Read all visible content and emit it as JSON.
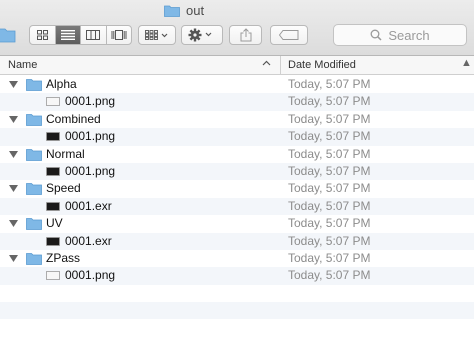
{
  "window": {
    "title": "out"
  },
  "toolbar": {
    "view_modes": [
      "icon-view",
      "list-view",
      "column-view",
      "coverflow-view"
    ],
    "active_view": "list-view",
    "arrange": "grid-icon",
    "action": "gear-icon",
    "share": "share-icon",
    "tags": "tag-icon",
    "search_placeholder": "Search"
  },
  "columns": {
    "name": "Name",
    "date": "Date Modified"
  },
  "rows": [
    {
      "type": "folder",
      "name": "Alpha",
      "date": "Today, 5:07 PM"
    },
    {
      "type": "file",
      "thumb": "light",
      "name": "0001.png",
      "date": "Today, 5:07 PM"
    },
    {
      "type": "folder",
      "name": "Combined",
      "date": "Today, 5:07 PM"
    },
    {
      "type": "file",
      "thumb": "dark",
      "name": "0001.png",
      "date": "Today, 5:07 PM"
    },
    {
      "type": "folder",
      "name": "Normal",
      "date": "Today, 5:07 PM"
    },
    {
      "type": "file",
      "thumb": "dark",
      "name": "0001.png",
      "date": "Today, 5:07 PM"
    },
    {
      "type": "folder",
      "name": "Speed",
      "date": "Today, 5:07 PM"
    },
    {
      "type": "file",
      "thumb": "dark",
      "name": "0001.exr",
      "date": "Today, 5:07 PM"
    },
    {
      "type": "folder",
      "name": "UV",
      "date": "Today, 5:07 PM"
    },
    {
      "type": "file",
      "thumb": "dark",
      "name": "0001.exr",
      "date": "Today, 5:07 PM"
    },
    {
      "type": "folder",
      "name": "ZPass",
      "date": "Today, 5:07 PM"
    },
    {
      "type": "file",
      "thumb": "light",
      "name": "0001.png",
      "date": "Today, 5:07 PM"
    }
  ],
  "colors": {
    "folder": "#7fb8e6",
    "alt_row": "#f3f6fa",
    "date_text": "#8c8c8c"
  }
}
